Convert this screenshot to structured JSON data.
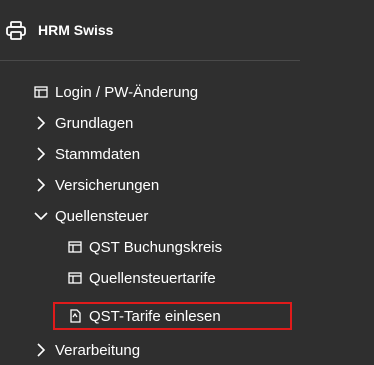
{
  "header": {
    "title": "HRM Swiss",
    "icon": "printer-icon"
  },
  "nav": {
    "items": [
      {
        "label": "Login / PW-Änderung",
        "icon": "table-icon"
      },
      {
        "label": "Grundlagen",
        "icon": "chevron-right-icon"
      },
      {
        "label": "Stammdaten",
        "icon": "chevron-right-icon"
      },
      {
        "label": "Versicherungen",
        "icon": "chevron-right-icon"
      },
      {
        "label": "Quellensteuer",
        "icon": "chevron-down-icon",
        "expanded": true
      },
      {
        "label": "QST Buchungskreis",
        "icon": "table-icon"
      },
      {
        "label": "Quellensteuertarife",
        "icon": "table-icon"
      },
      {
        "label": "QST-Tarife einlesen",
        "icon": "file-icon",
        "highlighted": true
      },
      {
        "label": "Verarbeitung",
        "icon": "chevron-right-icon"
      }
    ]
  },
  "colors": {
    "background": "#2f2f2f",
    "text": "#ffffff",
    "highlight_border": "#e01b1b"
  }
}
